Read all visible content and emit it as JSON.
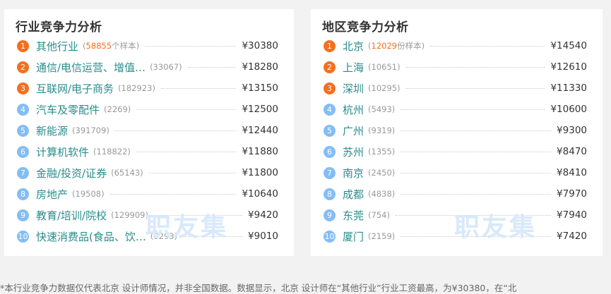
{
  "colors": {
    "top_rank": "#f46f1f",
    "other_rank": "#84bdf5",
    "name_text": "#2a8c8c",
    "watermark": "#d8e9fb"
  },
  "industry": {
    "title": "行业竞争力分析",
    "watermark": "职友集",
    "items": [
      {
        "rank": "1",
        "name": "其他行业",
        "count": "58855",
        "count_suffix": "个样本",
        "salary": "¥30380"
      },
      {
        "rank": "2",
        "name": "通信/电信运营、增值…",
        "count": "(33067)",
        "count_suffix": "",
        "salary": "¥18280"
      },
      {
        "rank": "3",
        "name": "互联网/电子商务",
        "count": "(182923)",
        "count_suffix": "",
        "salary": "¥13150"
      },
      {
        "rank": "4",
        "name": "汽车及零配件",
        "count": "(2269)",
        "count_suffix": "",
        "salary": "¥12500"
      },
      {
        "rank": "5",
        "name": "新能源",
        "count": "(391709)",
        "count_suffix": "",
        "salary": "¥12440"
      },
      {
        "rank": "6",
        "name": "计算机软件",
        "count": "(118822)",
        "count_suffix": "",
        "salary": "¥11880"
      },
      {
        "rank": "7",
        "name": "金融/投资/证券",
        "count": "(65143)",
        "count_suffix": "",
        "salary": "¥11800"
      },
      {
        "rank": "8",
        "name": "房地产",
        "count": "(19508)",
        "count_suffix": "",
        "salary": "¥10640"
      },
      {
        "rank": "9",
        "name": "教育/培训/院校",
        "count": "(129909)",
        "count_suffix": "",
        "salary": "¥9420"
      },
      {
        "rank": "10",
        "name": "快速消费品(食品、饮…",
        "count": "(9293)",
        "count_suffix": "",
        "salary": "¥9010"
      }
    ]
  },
  "region": {
    "title": "地区竞争力分析",
    "watermark": "职友集",
    "items": [
      {
        "rank": "1",
        "name": "北京",
        "count": "12029",
        "count_suffix": "份样本",
        "salary": "¥14540"
      },
      {
        "rank": "2",
        "name": "上海",
        "count": "(10651)",
        "count_suffix": "",
        "salary": "¥12610"
      },
      {
        "rank": "3",
        "name": "深圳",
        "count": "(10295)",
        "count_suffix": "",
        "salary": "¥11330"
      },
      {
        "rank": "4",
        "name": "杭州",
        "count": "(5493)",
        "count_suffix": "",
        "salary": "¥10600"
      },
      {
        "rank": "5",
        "name": "广州",
        "count": "(9319)",
        "count_suffix": "",
        "salary": "¥9300"
      },
      {
        "rank": "6",
        "name": "苏州",
        "count": "(1355)",
        "count_suffix": "",
        "salary": "¥8470"
      },
      {
        "rank": "7",
        "name": "南京",
        "count": "(2450)",
        "count_suffix": "",
        "salary": "¥8410"
      },
      {
        "rank": "8",
        "name": "成都",
        "count": "(4838)",
        "count_suffix": "",
        "salary": "¥7970"
      },
      {
        "rank": "9",
        "name": "东莞",
        "count": "(754)",
        "count_suffix": "",
        "salary": "¥7940"
      },
      {
        "rank": "10",
        "name": "厦门",
        "count": "(2159)",
        "count_suffix": "",
        "salary": "¥7420"
      }
    ]
  },
  "footnote": "*本行业竞争力数据仅代表北京 设计师情况，并非全国数据。数据显示，北京 设计师在“其他行业”行业工资最高，为¥30380，在“北"
}
